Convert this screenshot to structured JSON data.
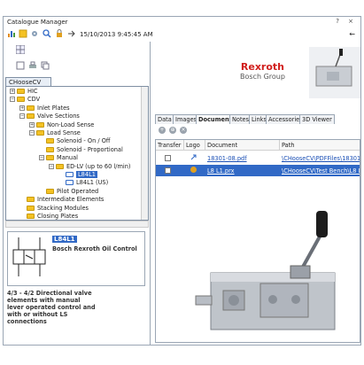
{
  "window": {
    "title": "Catalogue Manager",
    "title_buttons": "? ×",
    "back_arrow": "←"
  },
  "toolbar": {
    "timestamp": "15/10/2013 9:45:45 AM"
  },
  "left": {
    "tab_label": "CHooseCV",
    "tree": [
      {
        "label": "HIC",
        "level": 0,
        "expander": "+"
      },
      {
        "label": "CDV",
        "level": 0,
        "expander": "−"
      },
      {
        "label": "Inlet Plates",
        "level": 1,
        "expander": "+"
      },
      {
        "label": "Valve Sections",
        "level": 1,
        "expander": "−"
      },
      {
        "label": "Non-Load Sense",
        "level": 2,
        "expander": "+"
      },
      {
        "label": "Load Sense",
        "level": 2,
        "expander": "−"
      },
      {
        "label": "Solenoid - On / Off",
        "level": 3,
        "expander": ""
      },
      {
        "label": "Solenoid - Proportional",
        "level": 3,
        "expander": ""
      },
      {
        "label": "Manual",
        "level": 3,
        "expander": "−"
      },
      {
        "label": "ED-LV (up to 60 l/min)",
        "level": 4,
        "expander": "−"
      },
      {
        "label": "L84L1",
        "level": 5,
        "expander": "",
        "selected": true
      },
      {
        "label": "L84L1 (US)",
        "level": 5,
        "expander": ""
      },
      {
        "label": "Pilot Operated",
        "level": 3,
        "expander": ""
      },
      {
        "label": "Intermediate Elements",
        "level": 1,
        "expander": ""
      },
      {
        "label": "Stacking Modules",
        "level": 1,
        "expander": ""
      },
      {
        "label": "Closing Plates",
        "level": 1,
        "expander": ""
      }
    ],
    "preview": {
      "code": "L84L1",
      "brand": "Bosch Rexroth Oil Control",
      "description": "4/3 - 4/2 Directional valve elements with manual lever operated control and with or without LS connections"
    }
  },
  "right": {
    "brand_name": "Rexroth",
    "brand_sub": "Bosch Group",
    "tabs": [
      "Data",
      "Images",
      "Documents",
      "Notes",
      "Links",
      "Accessories",
      "3D Viewer"
    ],
    "active_tab": "Documents",
    "table": {
      "headers": [
        "Transfer",
        "Logo",
        "Document",
        "Path"
      ],
      "rows": [
        {
          "document": "18301-08.pdf",
          "path": "\\CHooseCV\\PDFFiles\\18301-0",
          "selected": false
        },
        {
          "document": "L8 L1.prx",
          "path": "\\CHooseCV\\Test Bench\\L8 L",
          "selected": true
        }
      ]
    }
  },
  "colors": {
    "accent": "#3169c6",
    "brand": "#d1201e",
    "folder": "#f4c224"
  }
}
